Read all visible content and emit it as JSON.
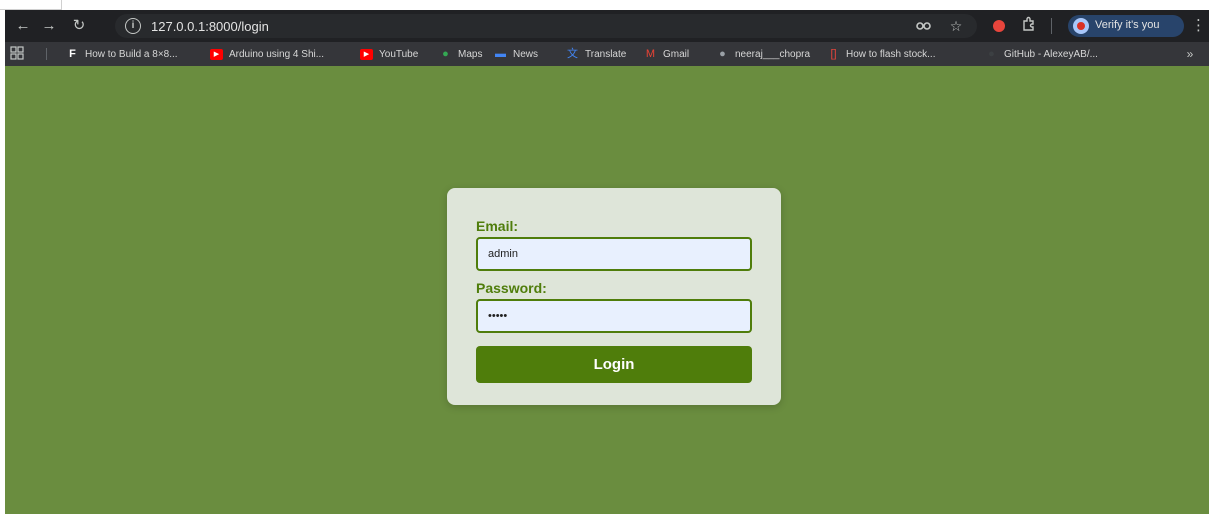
{
  "browser": {
    "nav": {
      "back_icon": "←",
      "forward_icon": "→",
      "reload_icon": "↻"
    },
    "url": "127.0.0.1:8000/login",
    "profile": {
      "label": "Verify it's you"
    },
    "bookmarks": [
      {
        "label": "How to Build a 8×8...",
        "icon": "F",
        "color": "#ffffff"
      },
      {
        "label": "Arduino using 4 Shi...",
        "icon": "▶",
        "color": "#ff0000"
      },
      {
        "label": "YouTube",
        "icon": "▶",
        "color": "#ff0000"
      },
      {
        "label": "Maps",
        "icon": "●",
        "color": "#34a853"
      },
      {
        "label": "News",
        "icon": "▬",
        "color": "#4285f4"
      },
      {
        "label": "Translate",
        "icon": "文",
        "color": "#4285f4"
      },
      {
        "label": "Gmail",
        "icon": "M",
        "color": "#ea4335"
      },
      {
        "label": "neeraj___chopra",
        "icon": "●",
        "color": "#9aa0a6"
      },
      {
        "label": "How to flash stock...",
        "icon": "[]",
        "color": "#e8453c"
      },
      {
        "label": "GitHub - AlexeyAB/...",
        "icon": "●",
        "color": "#3c4043"
      }
    ],
    "more": "»"
  },
  "page": {
    "background": "#6a8d3f",
    "accent": "#4f7d0b"
  },
  "login": {
    "email_label": "Email:",
    "email_value": "admin",
    "password_label": "Password:",
    "password_value": "admin",
    "button_label": "Login"
  }
}
